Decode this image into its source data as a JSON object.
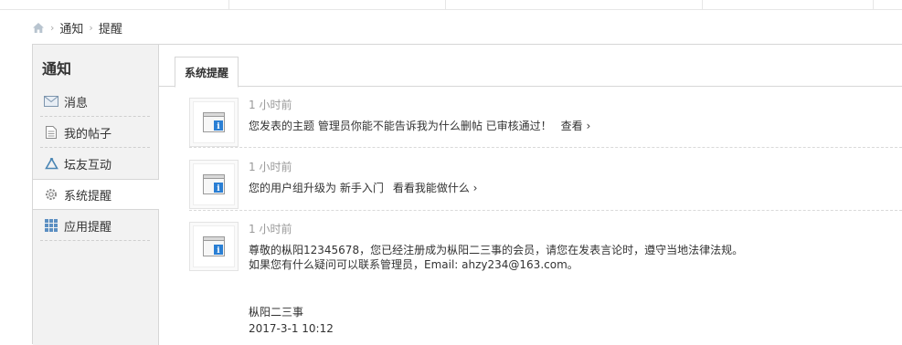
{
  "breadcrumb": {
    "home_icon": "home-icon",
    "items": [
      "通知",
      "提醒"
    ],
    "separator": "›"
  },
  "sidebar": {
    "title": "通知",
    "items": [
      {
        "label": "消息",
        "icon": "envelope-icon"
      },
      {
        "label": "我的帖子",
        "icon": "document-icon"
      },
      {
        "label": "坛友互动",
        "icon": "recycle-icon"
      },
      {
        "label": "系统提醒",
        "icon": "gear-icon",
        "active": true
      },
      {
        "label": "应用提醒",
        "icon": "grid-icon"
      }
    ]
  },
  "tabs": [
    {
      "label": "系统提醒",
      "active": true
    }
  ],
  "notices": [
    {
      "time": "1 小时前",
      "text": "您发表的主题 管理员你能不能告诉我为什么删帖 已审核通过！",
      "link": "查看 ›",
      "icon": "system-notice-icon"
    },
    {
      "time": "1 小时前",
      "text": "您的用户组升级为 新手入门",
      "link": "看看我能做什么 ›",
      "icon": "system-notice-icon"
    },
    {
      "time": "1 小时前",
      "text": "尊敬的枞阳12345678，您已经注册成为枞阳二三事的会员，请您在发表言论时，遵守当地法律法规。",
      "line2": "如果您有什么疑问可以联系管理员，Email: ahzy234@163.com。",
      "signature": "枞阳二三事",
      "date": "2017-3-1 10:12",
      "icon": "system-notice-icon"
    }
  ],
  "colors": {
    "border": "#d6d6d6",
    "sidebar_bg": "#f2f2f2",
    "muted_text": "#999999",
    "notice_icon_blue": "#2a7fd4"
  }
}
